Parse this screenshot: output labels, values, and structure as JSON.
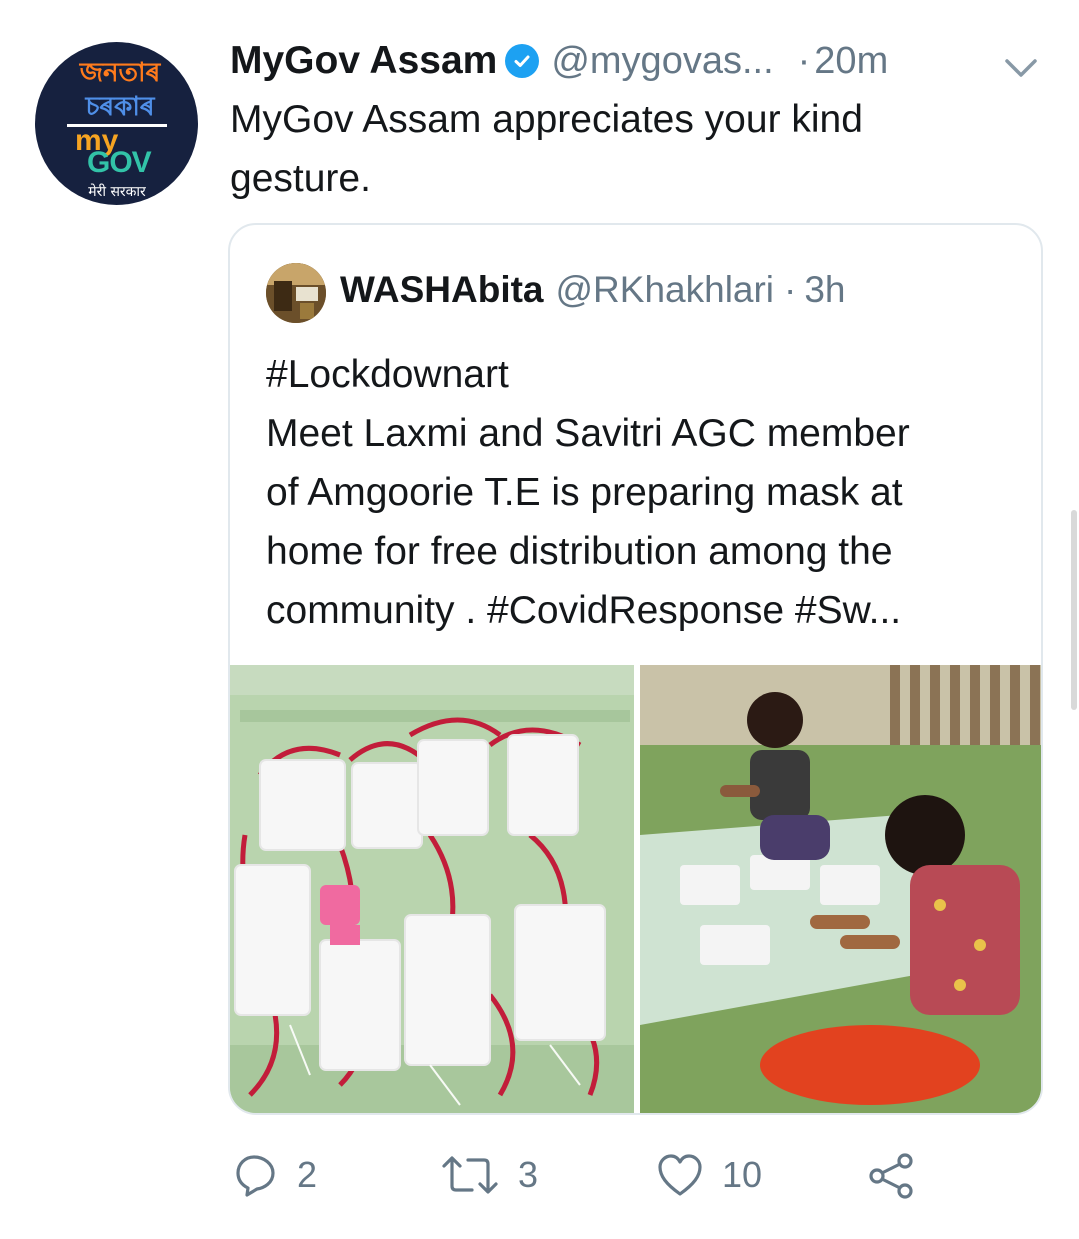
{
  "tweet": {
    "avatar": {
      "line1": "জনতাৰ",
      "line2": "চৰকাৰ",
      "my": "my",
      "gov": "GOV",
      "subtitle": "मेरी सरकार"
    },
    "display_name": "MyGov Assam",
    "handle": "@mygovas...",
    "dot": "·",
    "time": "20m",
    "text_line1": "MyGov Assam appreciates your kind",
    "text_line2": "gesture."
  },
  "quoted": {
    "display_name": "WASHAbita",
    "handle": "@RKhakhlari",
    "dot": "·",
    "time": "3h",
    "lines": [
      "#Lockdownart",
      "Meet Laxmi and Savitri AGC member",
      "of Amgoorie T.E is preparing mask at",
      "home for free distribution among the",
      "community . #CovidResponse #Sw..."
    ]
  },
  "actions": {
    "reply_count": "2",
    "retweet_count": "3",
    "like_count": "10"
  },
  "colors": {
    "accent": "#1da1f2",
    "secondary_text": "#657786",
    "primary_text": "#14171a",
    "border": "#e1e8ed"
  },
  "icons": [
    "verified-icon",
    "chevron-down-icon",
    "reply-icon",
    "retweet-icon",
    "like-icon",
    "share-icon"
  ]
}
